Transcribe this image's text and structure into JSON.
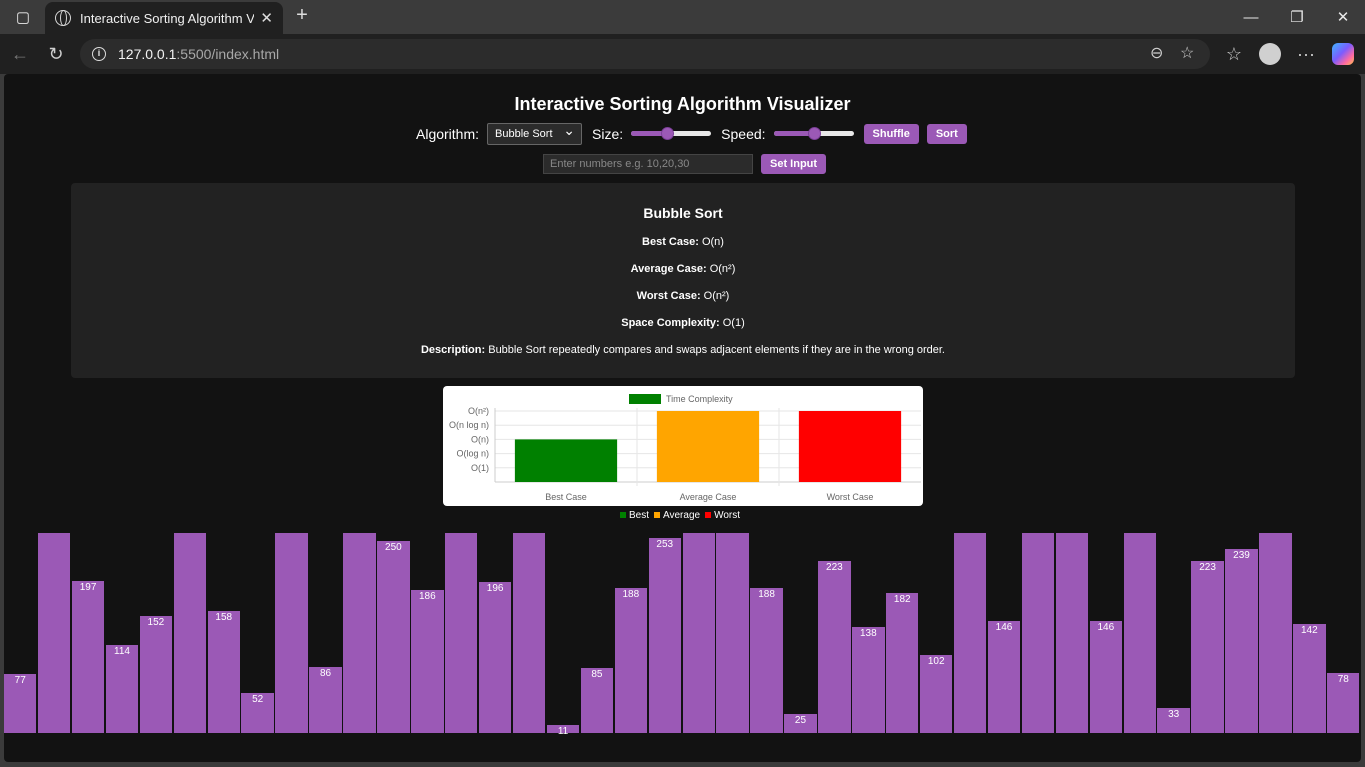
{
  "browser": {
    "tab_title": "Interactive Sorting Algorithm Visu",
    "url_host": "127.0.0.1",
    "url_path": ":5500/index.html"
  },
  "header": {
    "title": "Interactive Sorting Algorithm Visualizer"
  },
  "controls": {
    "algorithm_label": "Algorithm:",
    "algorithm_value": "Bubble Sort",
    "size_label": "Size:",
    "size_value": 0.45,
    "speed_label": "Speed:",
    "speed_value": 0.5,
    "shuffle_label": "Shuffle",
    "sort_label": "Sort",
    "input_placeholder": "Enter numbers e.g. 10,20,30",
    "set_input_label": "Set Input"
  },
  "info": {
    "name": "Bubble Sort",
    "best_label": "Best Case:",
    "best_value": " O(n)",
    "average_label": "Average Case:",
    "average_value": " O(n²)",
    "worst_label": "Worst Case:",
    "worst_value": " O(n²)",
    "space_label": "Space Complexity:",
    "space_value": " O(1)",
    "description_label": "Description:",
    "description_value": " Bubble Sort repeatedly compares and swaps adjacent elements if they are in the wrong order."
  },
  "chart_data": {
    "type": "bar",
    "categories": [
      "Best Case",
      "Average Case",
      "Worst Case"
    ],
    "y_ticks": [
      "O(1)",
      "O(log n)",
      "O(n)",
      "O(n log n)",
      "O(n²)"
    ],
    "values": [
      3,
      5,
      5
    ],
    "ylim": [
      0,
      5
    ],
    "colors": [
      "#008000",
      "#ffa500",
      "#ff0000"
    ],
    "series": [
      {
        "name": "Time Complexity",
        "values": [
          3,
          5,
          5
        ]
      }
    ],
    "legend_placement": "top"
  },
  "legend": {
    "items": [
      {
        "label": "Best",
        "color": "#008000"
      },
      {
        "label": "Average",
        "color": "#ffa500"
      },
      {
        "label": "Worst",
        "color": "#ff0000"
      }
    ]
  },
  "array": {
    "max": 260,
    "values": [
      77,
      260,
      197,
      114,
      152,
      260,
      158,
      52,
      260,
      86,
      260,
      250,
      186,
      260,
      196,
      260,
      11,
      85,
      188,
      253,
      260,
      260,
      188,
      25,
      223,
      138,
      182,
      102,
      260,
      146,
      260,
      260,
      146,
      260,
      33,
      223,
      239,
      260,
      142,
      78
    ],
    "labels": [
      "77",
      "",
      "197",
      "114",
      "152",
      "",
      "158",
      "52",
      "",
      "86",
      "",
      "250",
      "186",
      "",
      "196",
      "",
      "11",
      "85",
      "188",
      "253",
      "",
      "",
      "188",
      "25",
      "223",
      "138",
      "182",
      "102",
      "",
      "146",
      "",
      "",
      "146",
      "",
      "33",
      "223",
      "239",
      "",
      "142",
      "78"
    ]
  }
}
